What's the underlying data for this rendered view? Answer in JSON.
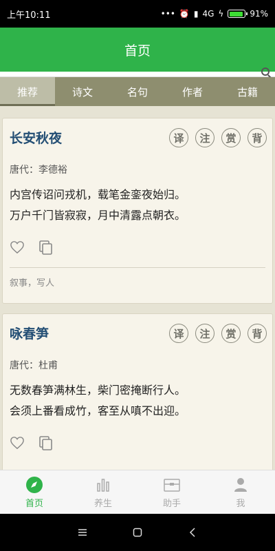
{
  "status_bar": {
    "time": "上午10:11",
    "dots": "•••",
    "network": "4G",
    "battery": "91%",
    "battery_fraction": 0.91
  },
  "header": {
    "title": "首页"
  },
  "tabs": [
    {
      "label": "推荐",
      "active": true
    },
    {
      "label": "诗文",
      "active": false
    },
    {
      "label": "名句",
      "active": false
    },
    {
      "label": "作者",
      "active": false
    },
    {
      "label": "古籍",
      "active": false
    }
  ],
  "badge_labels": [
    "译",
    "注",
    "赏",
    "背"
  ],
  "cards": [
    {
      "title": "长安秋夜",
      "dynasty": "唐代：李德裕",
      "lines": [
        "内宫传诏问戎机，载笔金銮夜始归。",
        "万户千门皆寂寂，月中清露点朝衣。"
      ],
      "tags": "叙事，写人"
    },
    {
      "title": "咏春笋",
      "dynasty": "唐代：杜甫",
      "lines": [
        "无数春笋满林生，柴门密掩断行人。",
        "会须上番看成竹，客至从嗔不出迎。"
      ],
      "tags": ""
    }
  ],
  "bottom_nav": [
    {
      "label": "首页",
      "icon": "compass-icon",
      "active": true
    },
    {
      "label": "养生",
      "icon": "bar-chart-icon",
      "active": false
    },
    {
      "label": "助手",
      "icon": "toolbox-icon",
      "active": false
    },
    {
      "label": "我",
      "icon": "person-icon",
      "active": false
    }
  ],
  "colors": {
    "accent": "#2fb34a",
    "tab_bar": "#8e8e6f",
    "title": "#234e74"
  }
}
